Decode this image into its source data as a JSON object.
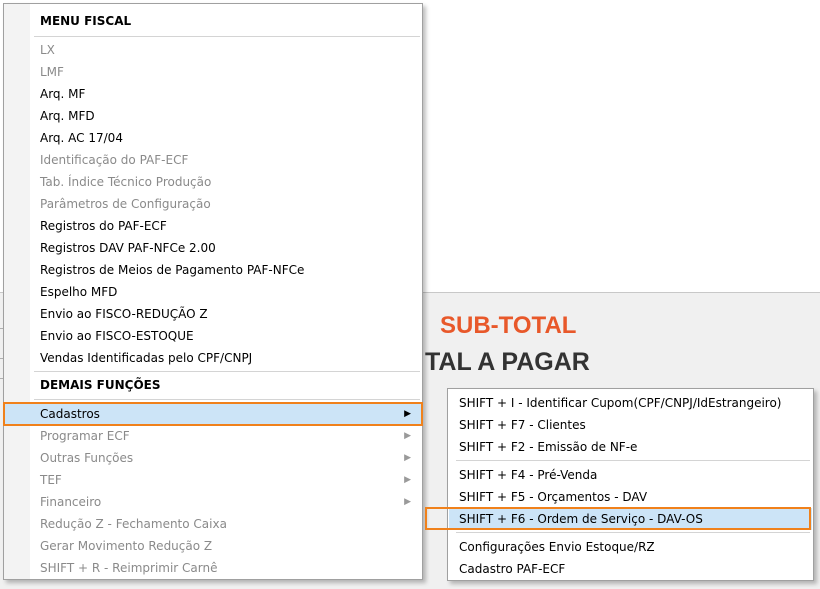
{
  "background": {
    "subtotal_label": "SUB-TOTAL",
    "total_label": "TAL A PAGAR"
  },
  "menu": {
    "section_fiscal": "MENU FISCAL",
    "fiscal_items": [
      {
        "label": "LX",
        "enabled": false
      },
      {
        "label": "LMF",
        "enabled": false
      },
      {
        "label": "Arq. MF",
        "enabled": true
      },
      {
        "label": "Arq. MFD",
        "enabled": true
      },
      {
        "label": "Arq. AC 17/04",
        "enabled": true
      },
      {
        "label": "Identificação do PAF-ECF",
        "enabled": false
      },
      {
        "label": "Tab. Índice Técnico Produção",
        "enabled": false
      },
      {
        "label": "Parâmetros de Configuração",
        "enabled": false
      },
      {
        "label": "Registros do PAF-ECF",
        "enabled": true
      },
      {
        "label": "Registros DAV PAF-NFCe 2.00",
        "enabled": true
      },
      {
        "label": "Registros de Meios de Pagamento PAF-NFCe",
        "enabled": true
      },
      {
        "label": "Espelho MFD",
        "enabled": true
      },
      {
        "label": "Envio ao FISCO-REDUÇÃO Z",
        "enabled": true
      },
      {
        "label": "Envio ao FISCO-ESTOQUE",
        "enabled": true
      },
      {
        "label": "Vendas Identificadas pelo CPF/CNPJ",
        "enabled": true
      }
    ],
    "section_demais": "DEMAIS FUNÇÕES",
    "demais_items": [
      {
        "label": "Cadastros",
        "enabled": true,
        "submenu": true,
        "highlighted": true
      },
      {
        "label": "Programar ECF",
        "enabled": false,
        "submenu": true
      },
      {
        "label": "Outras Funções",
        "enabled": false,
        "submenu": true
      },
      {
        "label": "TEF",
        "enabled": false,
        "submenu": true
      },
      {
        "label": "Financeiro",
        "enabled": false,
        "submenu": true
      },
      {
        "label": "Redução Z - Fechamento Caixa",
        "enabled": false
      },
      {
        "label": "Gerar Movimento Redução Z",
        "enabled": false
      },
      {
        "label": "SHIFT + R - Reimprimir Carnê",
        "enabled": false
      }
    ]
  },
  "submenu": {
    "groups": [
      [
        {
          "label": "SHIFT + I - Identificar Cupom(CPF/CNPJ/IdEstrangeiro)"
        },
        {
          "label": "SHIFT + F7 - Clientes"
        },
        {
          "label": "SHIFT + F2 - Emissão de NF-e"
        }
      ],
      [
        {
          "label": "SHIFT + F4 - Pré-Venda"
        },
        {
          "label": "SHIFT + F5 - Orçamentos - DAV"
        },
        {
          "label": "SHIFT + F6 - Ordem de Serviço - DAV-OS",
          "highlighted": true
        }
      ],
      [
        {
          "label": "Configurações Envio Estoque/RZ"
        },
        {
          "label": "Cadastro PAF-ECF"
        }
      ]
    ]
  },
  "colors": {
    "highlight": "#cce4f7",
    "annotation_outline": "#f0811b",
    "subtotal": "#e8582a",
    "disabled_text": "#8a8a8a"
  }
}
